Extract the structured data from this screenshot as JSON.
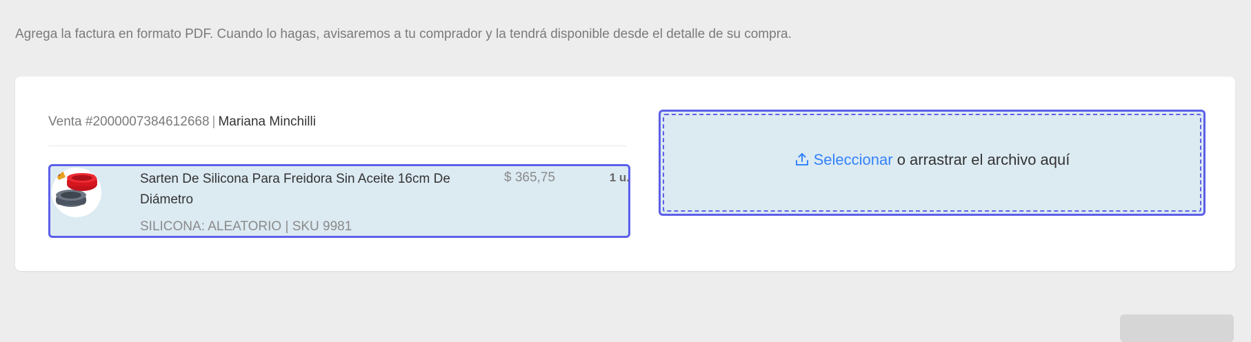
{
  "page": {
    "title_fragment": "",
    "subtitle": "Agrega la factura en formato PDF. Cuando lo hagas, avisaremos a tu comprador y la tendrá disponible desde el detalle de su compra."
  },
  "sale": {
    "number": "Venta #2000007384612668",
    "separator": "|",
    "buyer": "Mariana Minchilli"
  },
  "item": {
    "title": "Sarten De Silicona Para Freidora Sin Aceite 16cm De Diámetro",
    "variant": "SILICONA: ALEATORIO | SKU 9981",
    "price": "$ 365,75",
    "quantity": "1 u."
  },
  "upload": {
    "icon": "upload-icon",
    "select_label": "Seleccionar",
    "drag_label": " o arrastrar el archivo aquí"
  },
  "footer": {
    "link_label": "",
    "button_label": ""
  },
  "colors": {
    "background": "#ededed",
    "card": "#ffffff",
    "highlight_fill": "#dceaf2",
    "highlight_border": "#5b5fe8",
    "link": "#3483fa"
  }
}
